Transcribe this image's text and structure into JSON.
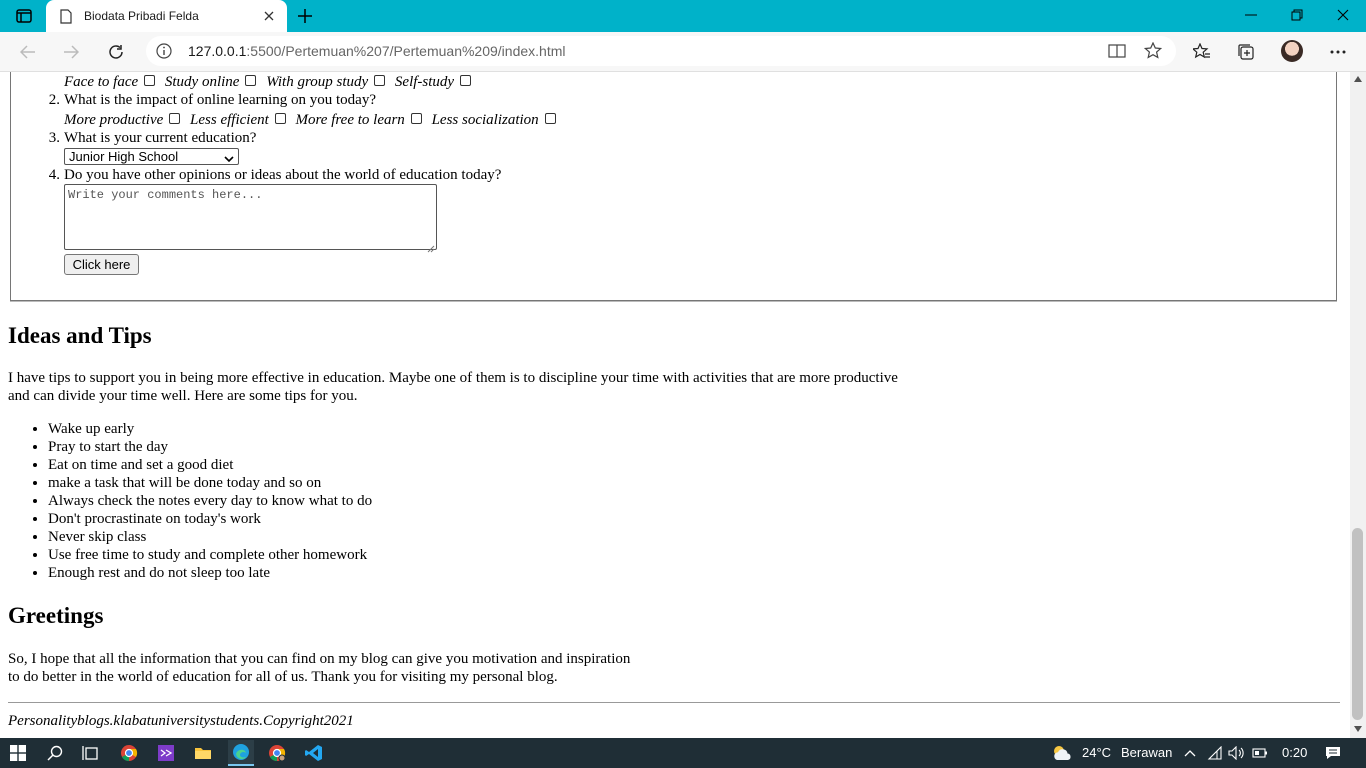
{
  "browser": {
    "tab_title": "Biodata Pribadi Felda",
    "url_host": "127.0.0.1",
    "url_rest": ":5500/Pertemuan%207/Pertemuan%209/index.html"
  },
  "form": {
    "q1_options": [
      "Face to face",
      "Study online",
      "With group study",
      "Self-study"
    ],
    "q2": {
      "number": "2.",
      "text": "What is the impact of online learning on you today?",
      "options": [
        "More productive",
        "Less efficient",
        "More free to learn",
        "Less socialization"
      ]
    },
    "q3": {
      "number": "3.",
      "text": "What is your current education?",
      "selected": "Junior High School"
    },
    "q4": {
      "number": "4.",
      "text": "Do you have other opinions or ideas about the world of education today?",
      "placeholder": "Write your comments here..."
    },
    "button_label": "Click here"
  },
  "ideas": {
    "heading": "Ideas and Tips",
    "para_line1": "I have tips to support you in being more effective in education. Maybe one of them is to discipline your time with activities that are more productive",
    "para_line2": "and can divide your time well. Here are some tips for you.",
    "tips": [
      "Wake up early",
      "Pray to start the day",
      "Eat on time and set a good diet",
      "make a task that will be done today and so on",
      "Always check the notes every day to know what to do",
      "Don't procrastinate on today's work",
      "Never skip class",
      "Use free time to study and complete other homework",
      "Enough rest and do not sleep too late"
    ]
  },
  "greetings": {
    "heading": "Greetings",
    "line1": "So, I hope that all the information that you can find on my blog can give you motivation and inspiration",
    "line2": "to do better in the world of education for all of us. Thank you for visiting my personal blog."
  },
  "footer": "Personalityblogs.klabatuniversitystudents.Copyright2021",
  "taskbar": {
    "weather_temp": "24°C",
    "weather_desc": "Berawan",
    "time": "0:20"
  },
  "colors": {
    "titlebar": "#00b2c9",
    "taskbar": "#1f2e36"
  }
}
